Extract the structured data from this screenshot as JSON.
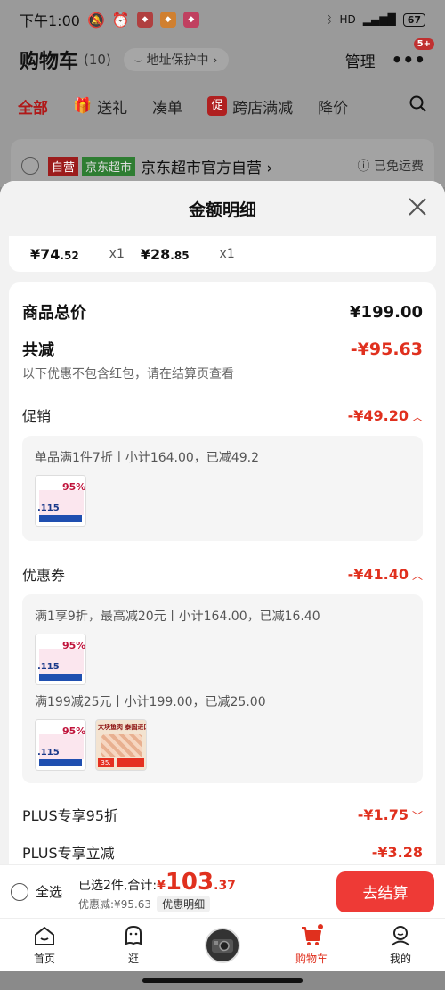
{
  "status_bar": {
    "time": "下午1:00",
    "battery": "67"
  },
  "cart_header": {
    "title": "购物车",
    "count": "(10)",
    "address_pill": "地址保护中",
    "manage": "管理",
    "more_badge": "5+"
  },
  "tabs": [
    {
      "label": "全部"
    },
    {
      "label": "送礼"
    },
    {
      "label": "凑单"
    },
    {
      "label": "跨店满减",
      "badge": "促"
    },
    {
      "label": "降价"
    }
  ],
  "shop": {
    "tag_self": "自营",
    "tag_jd": "京东超市",
    "name": "京东超市官方自营",
    "free_shipping": "已免运费"
  },
  "sheet": {
    "title": "金额明细",
    "items": [
      {
        "price_int": "¥74",
        "price_dec": ".52",
        "qty": "x1"
      },
      {
        "price_int": "¥28",
        "price_dec": ".85",
        "qty": "x1"
      }
    ],
    "total": {
      "label": "商品总价",
      "value": "¥199.00"
    },
    "reduce": {
      "label": "共减",
      "value": "-¥95.63",
      "hint": "以下优惠不包含红包，请在结算页查看"
    },
    "promo": {
      "label": "促销",
      "value": "-¥49.20",
      "line": "单品满1件7折丨小计164.00，已减49.2"
    },
    "coupon": {
      "label": "优惠券",
      "value": "-¥41.40",
      "line1": "满1享9折，最高减20元丨小计164.00，已减16.40",
      "line2": "满199减25元丨小计199.00，已减25.00"
    },
    "plus1": {
      "label": "PLUS专享95折",
      "value": "-¥1.75"
    },
    "plus2": {
      "label": "PLUS专享立减",
      "value": "-¥3.28"
    },
    "thumb_a": {
      "pct": "95%",
      "num": ".115"
    },
    "thumb_b": {
      "header": "大块鱼肉 泰国进口",
      "price": "35."
    }
  },
  "checkout": {
    "select_all": "全选",
    "selected_label": "已选2件,合计:",
    "yen": "¥",
    "amount_int": "103",
    "amount_dec": ".37",
    "discount_label": "优惠减:¥95.63",
    "detail_button": "优惠明细",
    "checkout_button": "去结算"
  },
  "nav": [
    {
      "label": "首页"
    },
    {
      "label": "逛"
    },
    {
      "label": "购物车"
    },
    {
      "label": "我的"
    }
  ]
}
